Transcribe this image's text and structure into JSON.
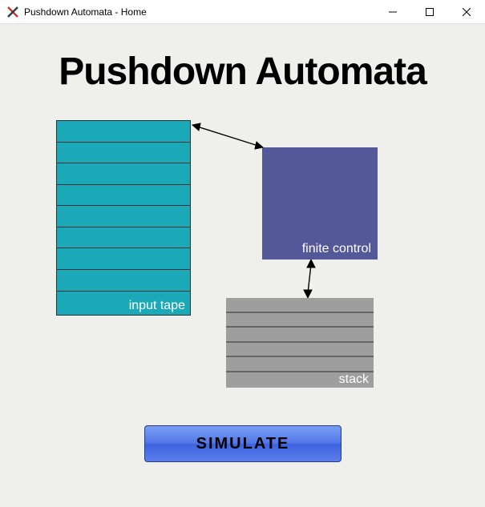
{
  "window": {
    "title": "Pushdown Automata - Home"
  },
  "heading": "Pushdown Automata",
  "diagram": {
    "input_tape_label": "input tape",
    "finite_control_label": "finite control",
    "stack_label": "stack",
    "input_tape_rows": 9,
    "stack_rows": 6,
    "colors": {
      "input_tape": "#1ba9b7",
      "finite_control": "#545899",
      "stack": "#9e9e9e"
    }
  },
  "buttons": {
    "simulate": "SIMULATE"
  }
}
